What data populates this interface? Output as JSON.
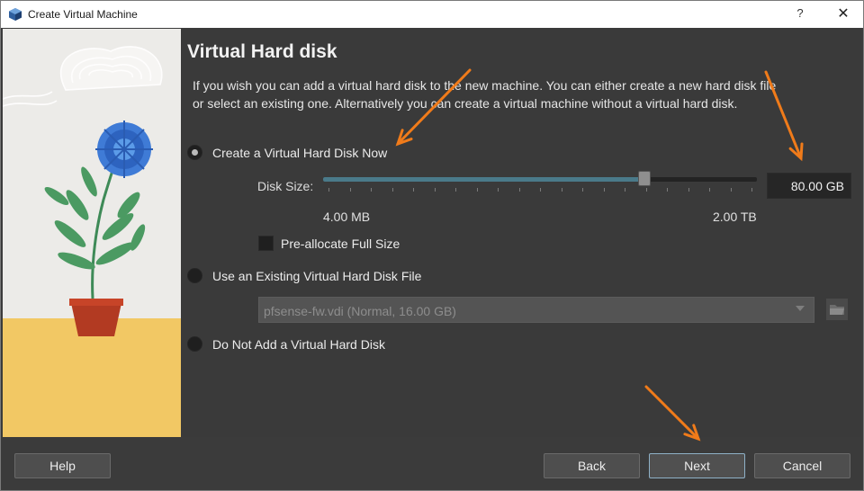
{
  "window": {
    "title": "Create Virtual Machine",
    "help_glyph": "?",
    "close_glyph": "✕"
  },
  "page": {
    "heading": "Virtual Hard disk",
    "description": "If you wish you can add a virtual hard disk to the new machine. You can either create a new hard disk file or select an existing one. Alternatively you can create a virtual machine without a virtual hard disk."
  },
  "options": {
    "create_now": {
      "label": "Create a Virtual Hard Disk Now",
      "checked": true
    },
    "use_existing": {
      "label": "Use an Existing Virtual Hard Disk File",
      "checked": false
    },
    "do_not_add": {
      "label": "Do Not Add a Virtual Hard Disk",
      "checked": false
    }
  },
  "disk": {
    "size_label": "Disk Size:",
    "size_value": "80.00 GB",
    "slider_fraction": 0.74,
    "range_min": "4.00 MB",
    "range_max": "2.00 TB",
    "preallocate_label": "Pre-allocate Full Size",
    "preallocate_checked": false
  },
  "existing": {
    "selected": "pfsense-fw.vdi (Normal, 16.00 GB)"
  },
  "buttons": {
    "help": "Help",
    "back": "Back",
    "next": "Next",
    "cancel": "Cancel"
  },
  "colors": {
    "annotation_arrow": "#f07b1a",
    "slider_fill": "#4a7a8a",
    "background": "#3a3a3a"
  },
  "icons": {
    "app": "virtualbox-icon",
    "folder": "folder-icon",
    "dropdown": "chevron-down-icon"
  }
}
